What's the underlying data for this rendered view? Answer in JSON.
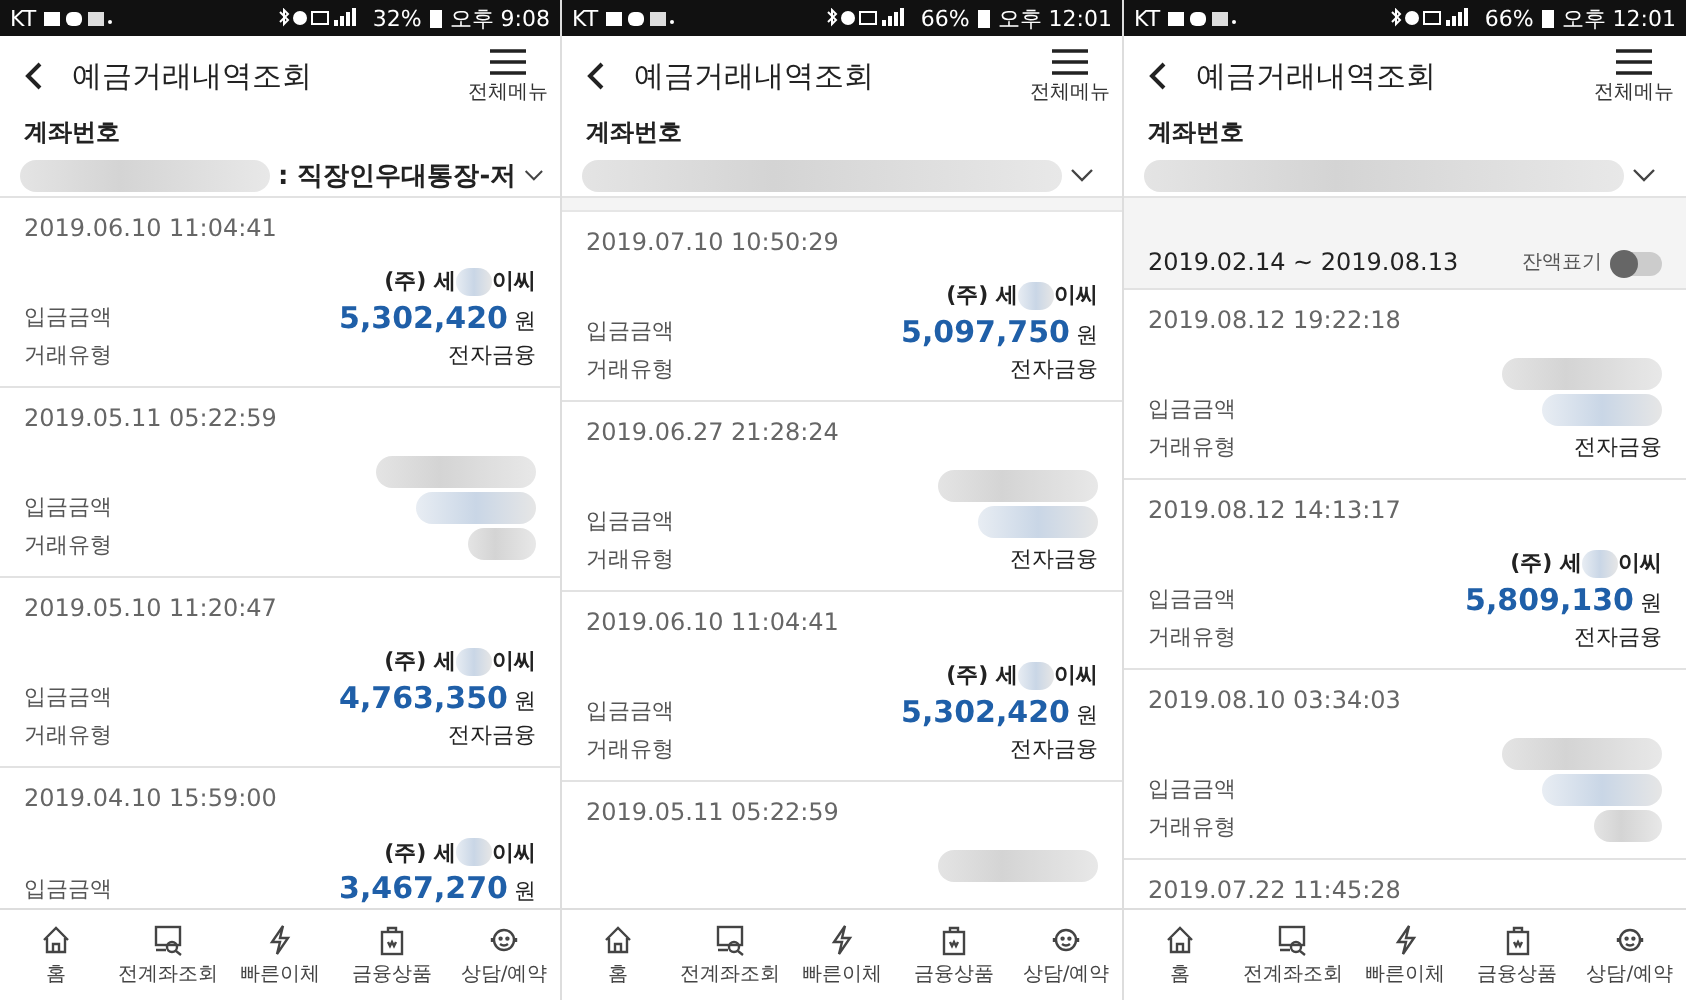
{
  "phones": [
    {
      "status_bar": {
        "carrier": "KT",
        "battery": "32%",
        "time": "오후 9:08"
      },
      "header": {
        "title": "예금거래내역조회",
        "menu_label": "전체메뉴"
      },
      "account": {
        "label": "계좌번호",
        "name": ": 직장인우대통장-저"
      },
      "transactions": [
        {
          "kind": "shown",
          "datetime": "2019.06.10 11:04:41",
          "payee_start": "(주) 세",
          "payee_end": "이씨",
          "amount_label": "입금금액",
          "amount": "5,302,420",
          "currency": "원",
          "type_label": "거래유형",
          "type_value": "전자금융"
        },
        {
          "kind": "masked",
          "datetime": "2019.05.11 05:22:59",
          "amount_label": "입금금액",
          "type_label": "거래유형"
        },
        {
          "kind": "shown",
          "datetime": "2019.05.10 11:20:47",
          "payee_start": "(주) 세",
          "payee_end": "이씨",
          "amount_label": "입금금액",
          "amount": "4,763,350",
          "currency": "원",
          "type_label": "거래유형",
          "type_value": "전자금융"
        },
        {
          "kind": "shown",
          "datetime": "2019.04.10 15:59:00",
          "payee_start": "(주) 세",
          "payee_end": "이씨",
          "amount_label": "입금금액",
          "amount": "3,467,270",
          "currency": "원"
        }
      ],
      "nav": [
        {
          "kind": "home",
          "label": "홈"
        },
        {
          "kind": "accounts",
          "label": "전계좌조회"
        },
        {
          "kind": "transfer",
          "label": "빠른이체"
        },
        {
          "kind": "products",
          "label": "금융상품"
        },
        {
          "kind": "support",
          "label": "상담/예약"
        }
      ]
    },
    {
      "status_bar": {
        "carrier": "KT",
        "battery": "66%",
        "time": "오후 12:01"
      },
      "header": {
        "title": "예금거래내역조회",
        "menu_label": "전체메뉴"
      },
      "account": {
        "label": "계좌번호"
      },
      "transactions": [
        {
          "kind": "shown",
          "datetime": "2019.07.10 10:50:29",
          "payee_start": "(주) 세",
          "payee_end": "이씨",
          "amount_label": "입금금액",
          "amount": "5,097,750",
          "currency": "원",
          "type_label": "거래유형",
          "type_value": "전자금융"
        },
        {
          "kind": "masked",
          "datetime": "2019.06.27 21:28:24",
          "amount_label": "입금금액",
          "type_label": "거래유형",
          "type_value": "전자금융"
        },
        {
          "kind": "shown",
          "datetime": "2019.06.10 11:04:41",
          "payee_start": "(주) 세",
          "payee_end": "이씨",
          "amount_label": "입금금액",
          "amount": "5,302,420",
          "currency": "원",
          "type_label": "거래유형",
          "type_value": "전자금융"
        },
        {
          "kind": "masked",
          "datetime": "2019.05.11 05:22:59"
        }
      ],
      "nav": [
        {
          "kind": "home",
          "label": "홈"
        },
        {
          "kind": "accounts",
          "label": "전계좌조회"
        },
        {
          "kind": "transfer",
          "label": "빠른이체"
        },
        {
          "kind": "products",
          "label": "금융상품"
        },
        {
          "kind": "support",
          "label": "상담/예약"
        }
      ]
    },
    {
      "status_bar": {
        "carrier": "KT",
        "battery": "66%",
        "time": "오후 12:01"
      },
      "header": {
        "title": "예금거래내역조회",
        "menu_label": "전체메뉴"
      },
      "account": {
        "label": "계좌번호"
      },
      "period": {
        "range": "2019.02.14 ~ 2019.08.13",
        "toggle_label": "잔액표기",
        "balance_on": false
      },
      "transactions": [
        {
          "kind": "masked",
          "datetime": "2019.08.12 19:22:18",
          "amount_label": "입금금액",
          "type_label": "거래유형",
          "type_value": "전자금융"
        },
        {
          "kind": "shown",
          "datetime": "2019.08.12 14:13:17",
          "payee_start": "(주) 세",
          "payee_end": "이씨",
          "amount_label": "입금금액",
          "amount": "5,809,130",
          "currency": "원",
          "type_label": "거래유형",
          "type_value": "전자금융"
        },
        {
          "kind": "masked",
          "datetime": "2019.08.10 03:34:03",
          "amount_label": "입금금액",
          "type_label": "거래유형"
        },
        {
          "kind": "masked",
          "datetime": "2019.07.22 11:45:28"
        }
      ],
      "nav": [
        {
          "kind": "home",
          "label": "홈"
        },
        {
          "kind": "accounts",
          "label": "전계좌조회"
        },
        {
          "kind": "transfer",
          "label": "빠른이체"
        },
        {
          "kind": "products",
          "label": "금융상품"
        },
        {
          "kind": "support",
          "label": "상담/예약"
        }
      ]
    }
  ]
}
